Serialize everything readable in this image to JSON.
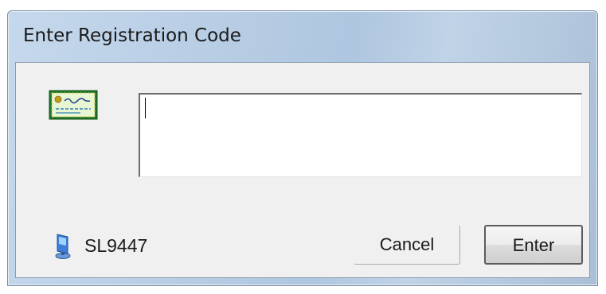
{
  "window": {
    "title": "Enter Registration Code"
  },
  "form": {
    "registration_code_value": "",
    "machine_id": "SL9447"
  },
  "buttons": {
    "cancel_label": "Cancel",
    "enter_label": "Enter"
  },
  "icons": {
    "certificate": "certificate-icon",
    "computer": "computer-icon"
  },
  "colors": {
    "title_bar": "#b7cde4",
    "client_background": "#f0f0f0",
    "certificate_border": "#1f7a2a"
  }
}
